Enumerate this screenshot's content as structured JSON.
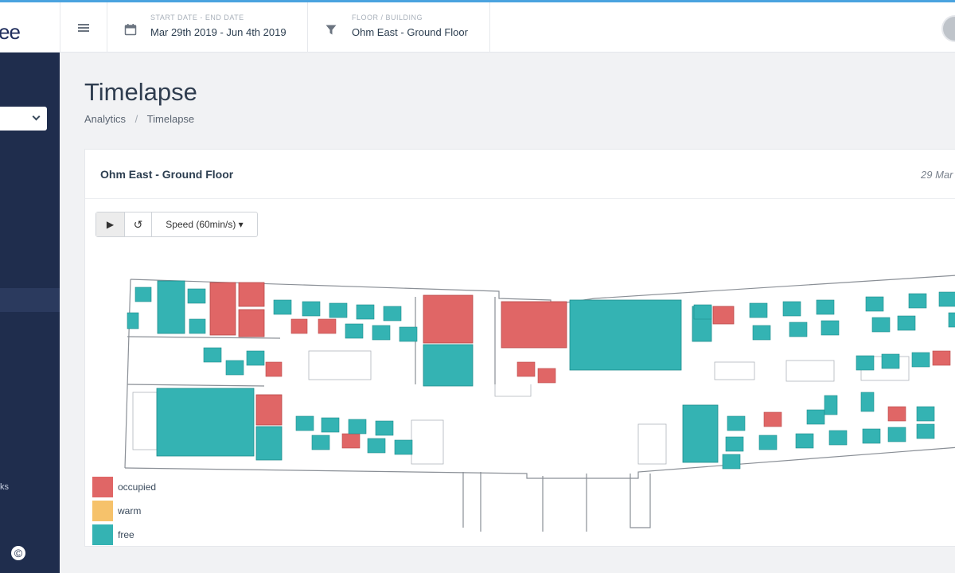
{
  "app": {
    "logo_text": "ee"
  },
  "header": {
    "date_label": "START DATE - END DATE",
    "date_value": "Mar 29th 2019 - Jun 4th 2019",
    "floor_label": "FLOOR / BUILDING",
    "floor_value": "Ohm East - Ground Floor"
  },
  "sidebar": {
    "partial_label": "ks",
    "copyright": "©"
  },
  "page": {
    "title": "Timelapse",
    "breadcrumb": [
      "Analytics",
      "/",
      "Timelapse"
    ]
  },
  "card": {
    "title": "Ohm East - Ground Floor",
    "date": "29 Mar"
  },
  "controls": {
    "play": "▶",
    "reset": "↺",
    "speed": "Speed (60min/s) ▾"
  },
  "legend": [
    {
      "label": "occupied",
      "color": "#e06666"
    },
    {
      "label": "warm",
      "color": "#f6c26b"
    },
    {
      "label": "free",
      "color": "#34b3b3"
    }
  ],
  "colors": {
    "occupied": "#e06666",
    "free": "#34b3b3",
    "sidebar": "#1f2d4d",
    "accent": "#4aa3df"
  }
}
